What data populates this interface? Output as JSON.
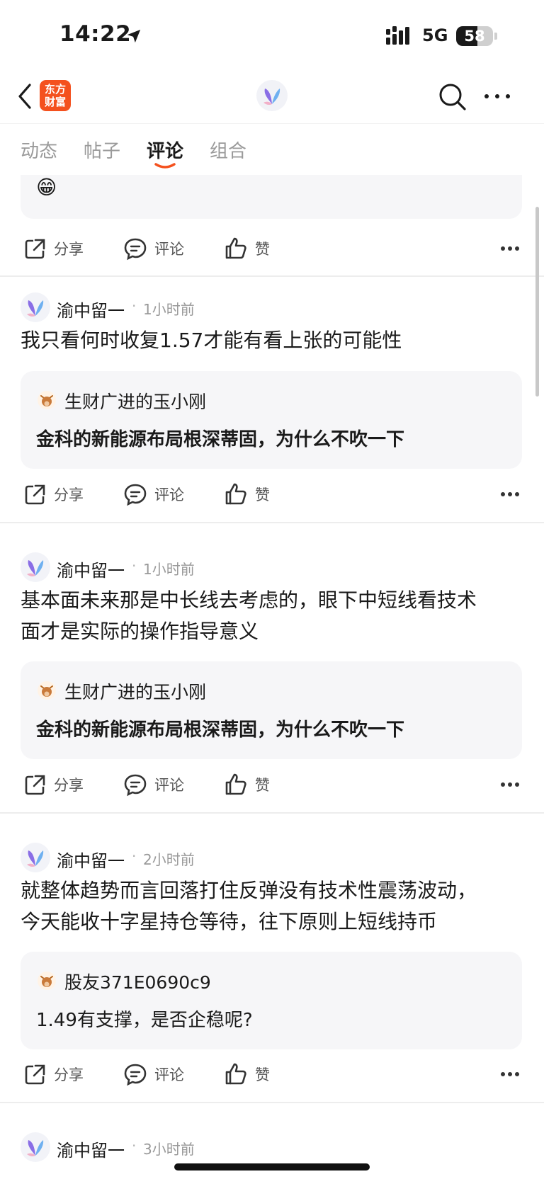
{
  "status_bar": {
    "time": "14:22",
    "network": "5G",
    "battery_level": "58",
    "battery_fraction": 0.58
  },
  "nav": {
    "app_logo_line1": "东方",
    "app_logo_line2": "财富",
    "icons": [
      "back-icon",
      "search-icon",
      "more-icon"
    ]
  },
  "tabs": [
    {
      "label": "动态"
    },
    {
      "label": "帖子"
    },
    {
      "label": "评论",
      "active": true
    },
    {
      "label": "组合"
    }
  ],
  "actions": {
    "share": "分享",
    "comment": "评论",
    "like": "赞"
  },
  "colors": {
    "accent": "#f4511e",
    "quote_bg": "#f6f6f8",
    "muted_text": "#999999"
  },
  "posts": [
    {
      "author": "渝中留一",
      "time": "1小时前",
      "content_lines": [
        "我只看何时收复1.57才能有看上张的可能性"
      ],
      "quote": {
        "author": "生财广进的玉小刚",
        "text": "金科的新能源布局根深蒂固，为什么不吹一下"
      }
    },
    {
      "author": "渝中留一",
      "time": "1小时前",
      "content_lines": [
        "基本面未来那是中长线去考虑的，眼下中短线看技术",
        "面才是实际的操作指导意义"
      ],
      "quote": {
        "author": "生财广进的玉小刚",
        "text": "金科的新能源布局根深蒂固，为什么不吹一下"
      }
    },
    {
      "author": "渝中留一",
      "time": "2小时前",
      "content_lines": [
        "就整体趋势而言回落打住反弹没有技术性震荡波动，",
        "今天能收十字星持仓等待，往下原则上短线持币"
      ],
      "quote": {
        "author": "股友371E0690c9",
        "text": "1.49有支撑，是否企稳呢?"
      }
    },
    {
      "author": "渝中留一",
      "time": "3小时前"
    }
  ]
}
